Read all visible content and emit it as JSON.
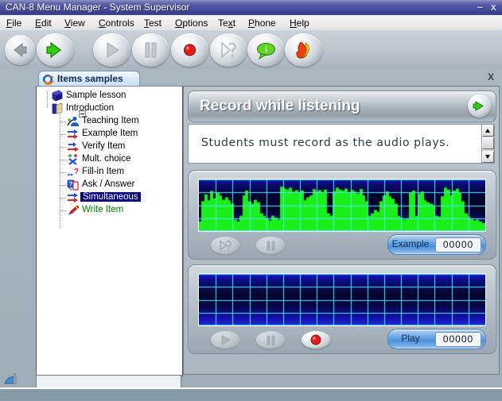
{
  "window": {
    "title": "CAN-8 Menu Manager - System Supervisor",
    "minimize_label": "–",
    "close_label": "x",
    "titlebar_color": "#4b51a0"
  },
  "menubar": {
    "items": [
      {
        "label": "File",
        "accel": "F"
      },
      {
        "label": "Edit",
        "accel": "E"
      },
      {
        "label": "View",
        "accel": "V"
      },
      {
        "label": "Controls",
        "accel": "C"
      },
      {
        "label": "Test",
        "accel": "T"
      },
      {
        "label": "Options",
        "accel": "O"
      },
      {
        "label": "Text",
        "accel": "x"
      },
      {
        "label": "Phone",
        "accel": "P"
      },
      {
        "label": "Help",
        "accel": "H"
      }
    ]
  },
  "toolbar": {
    "buttons": [
      {
        "name": "back-button",
        "icon": "left-arrow-icon",
        "state": "disabled",
        "color": "#8d9299"
      },
      {
        "name": "forward-button",
        "icon": "right-arrow-icon",
        "state": "enabled",
        "color": "#2ec413"
      },
      {
        "name": "play-button",
        "icon": "play-icon",
        "state": "disabled",
        "color": "#b6bcc3"
      },
      {
        "name": "pause-button",
        "icon": "pause-icon",
        "state": "disabled",
        "color": "#b6bcc3"
      },
      {
        "name": "record-button",
        "icon": "record-icon",
        "state": "enabled",
        "color": "#e02020"
      },
      {
        "name": "repeat-help-button",
        "icon": "play-question-icon",
        "state": "disabled",
        "color": "#b6bcc3"
      },
      {
        "name": "info-button",
        "icon": "info-balloon-icon",
        "state": "enabled",
        "color": "#5fd220"
      },
      {
        "name": "exit-button",
        "icon": "flame-icon",
        "state": "enabled",
        "color": "#e8500f"
      }
    ]
  },
  "tab": {
    "label": "Items samples",
    "icon": "browser-e-icon",
    "close_label": "X"
  },
  "tree": {
    "nodes": [
      {
        "label": "Sample lesson",
        "icon": "book-icon",
        "indent": 0,
        "selected": false,
        "color": "#000000"
      },
      {
        "label": "Introduction",
        "icon": "open-book-icon",
        "indent": 0,
        "selected": false,
        "color": "#000000"
      },
      {
        "label": "Teaching Item",
        "icon": "teaching-icon",
        "indent": 1,
        "selected": false,
        "color": "#000000"
      },
      {
        "label": "Example Item",
        "icon": "example-arrow-icon",
        "indent": 1,
        "selected": false,
        "color": "#000000"
      },
      {
        "label": "Verify Item",
        "icon": "verify-arrow-icon",
        "indent": 1,
        "selected": false,
        "color": "#000000"
      },
      {
        "label": "Mult. choice",
        "icon": "multiple-choice-icon",
        "indent": 1,
        "selected": false,
        "color": "#000000"
      },
      {
        "label": "Fill-in Item",
        "icon": "fill-in-icon",
        "indent": 1,
        "selected": false,
        "color": "#000000"
      },
      {
        "label": "Ask / Answer",
        "icon": "ask-answer-icon",
        "indent": 1,
        "selected": false,
        "color": "#000000"
      },
      {
        "label": "Simultaneous",
        "icon": "simultaneous-icon",
        "indent": 1,
        "selected": true,
        "color": "#ffffff"
      },
      {
        "label": "Write Item",
        "icon": "pencil-icon",
        "indent": 1,
        "selected": false,
        "color": "#008000"
      }
    ]
  },
  "content": {
    "banner_title": "Record while listening",
    "banner_next_icon": "green-right-arrow-icon",
    "description": "Students must record as the audio plays."
  },
  "example_panel": {
    "name": "example-recorder",
    "counter_label": "Example",
    "counter_value": "00000",
    "waveform": {
      "filled": true,
      "bar_color": "#19f019",
      "background_color": "#00007f",
      "grid_color": "#4fe8f2",
      "amplitudes": [
        0.18,
        0.6,
        0.74,
        0.62,
        0.81,
        0.66,
        0.77,
        0.72,
        0.63,
        0.68,
        0.62,
        0.55,
        0.22,
        0.18,
        0.3,
        0.72,
        0.82,
        0.6,
        0.55,
        0.63,
        0.58,
        0.35,
        0.3,
        0.25,
        0.2,
        0.3,
        0.26,
        0.22,
        0.9,
        0.86,
        0.84,
        0.88,
        0.8,
        0.83,
        0.78,
        0.82,
        0.62,
        0.68,
        0.72,
        0.85,
        0.8,
        0.83,
        0.79,
        0.84,
        0.35,
        0.3,
        0.8,
        0.88,
        0.84,
        0.82,
        0.86,
        0.79,
        0.83,
        0.8,
        0.76,
        0.85,
        0.72,
        0.6,
        0.3,
        0.35,
        0.42,
        0.38,
        0.6,
        0.72,
        0.8,
        0.7,
        0.65,
        0.55,
        0.3,
        0.26,
        0.22,
        0.25,
        0.78,
        0.82,
        0.3,
        0.76,
        0.8,
        0.62,
        0.58,
        0.55,
        0.52,
        0.3,
        0.28,
        0.7,
        0.88,
        0.84,
        0.72,
        0.82,
        0.86,
        0.78,
        0.6,
        0.35,
        0.28,
        0.24,
        0.2,
        0.22,
        0.18,
        0.15
      ]
    },
    "buttons": [
      {
        "name": "example-repeat-button",
        "icon": "play-question-icon",
        "state": "disabled"
      },
      {
        "name": "example-pause-button",
        "icon": "pause-icon",
        "state": "disabled"
      }
    ]
  },
  "play_panel": {
    "name": "student-recorder",
    "counter_label": "Play",
    "counter_value": "00000",
    "waveform": {
      "filled": false,
      "background_color": "#0000cc",
      "grid_color": "#4fe8f2",
      "amplitudes": []
    },
    "buttons": [
      {
        "name": "play-button",
        "icon": "play-icon",
        "state": "disabled"
      },
      {
        "name": "pause-button",
        "icon": "pause-icon",
        "state": "disabled"
      },
      {
        "name": "record-button",
        "icon": "record-icon",
        "state": "enabled"
      }
    ]
  },
  "desktop_icons": [
    {
      "name": "lessons-icon",
      "label": "",
      "icon": "books-green-arrow-icon"
    },
    {
      "name": "monitor-icon",
      "label": "",
      "icon": "monitor-headset-icon"
    },
    {
      "name": "tests-icon",
      "label": "",
      "icon": "grid-checkmark-icon"
    },
    {
      "name": "inbox-icon",
      "label": "",
      "icon": "media-inbox-icon"
    }
  ],
  "statusbar": {
    "icon": "small-tray-icon",
    "text": ""
  }
}
